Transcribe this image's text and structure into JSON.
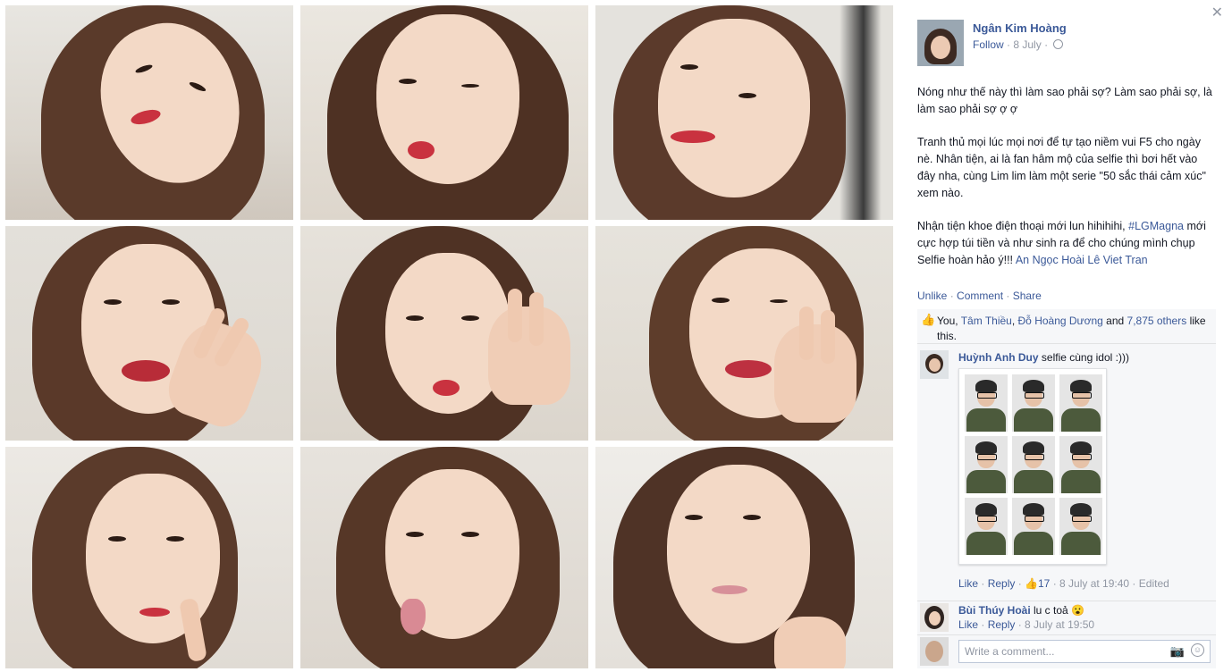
{
  "photo_grid": {
    "photo_count": 9
  },
  "post": {
    "author_name": "Ngân Kim Hoàng",
    "follow_label": "Follow",
    "date": "8 July",
    "paragraphs": [
      "Nóng như thế này thì làm sao phải sợ? Làm sao phải sợ, là làm sao phải sợ ợ ợ",
      "Tranh thủ mọi lúc mọi nơi để tự tạo niềm vui F5 cho ngày nè. Nhân tiện, ai là fan hâm mộ của selfie thì bơi hết vào đây nha, cùng Lim lim làm một serie \"50 sắc thái cảm xúc\" xem nào."
    ],
    "p3_before": "Nhận tiện khoe điện thoại mới lun hihihihi, ",
    "hashtag": "#LGMagna",
    "p3_after": " mới cực hợp túi tiền và như sinh ra để cho chúng mình chụp Selfie hoàn hảo ý!!! ",
    "tag1": "An Ngọc Hoài",
    "tag2": "Lê Viet Tran"
  },
  "actions": {
    "unlike": "Unlike",
    "comment": "Comment",
    "share": "Share"
  },
  "likes": {
    "you": "You, ",
    "person1": "Tâm Thiều",
    "person2": "Đỗ Hoàng Dương",
    "and_text": " and ",
    "others": "7,875 others",
    "suffix": " like this."
  },
  "comments": [
    {
      "author": "Huỳnh Anh Duy",
      "text": " selfie cùng idol :)))",
      "like": "Like",
      "reply": "Reply",
      "like_count": "17",
      "time": "8 July at 19:40",
      "edited": "Edited"
    },
    {
      "author": "Bùi Thúy Hoài",
      "text": " lu c toả 😮",
      "like": "Like",
      "reply": "Reply",
      "time": "8 July at 19:50"
    }
  ],
  "composer": {
    "placeholder": "Write a comment..."
  },
  "icons": {
    "close": "close-icon",
    "globe": "globe-icon",
    "thumb": "thumbs-up-icon",
    "camera": "camera-icon",
    "smiley": "smiley-icon"
  },
  "colors": {
    "link": "#3b5998",
    "meta": "#9197a3",
    "lips": "#c9323f"
  }
}
